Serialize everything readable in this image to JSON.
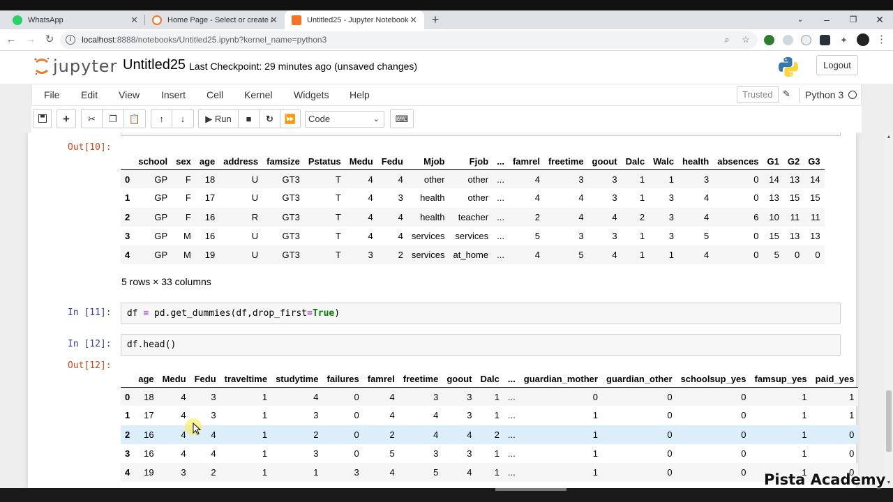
{
  "browser": {
    "tabs": [
      {
        "label": "WhatsApp",
        "icon": "whatsapp-icon",
        "active": false
      },
      {
        "label": "Home Page - Select or create a n",
        "icon": "jupyter-icon",
        "active": false
      },
      {
        "label": "Untitled25 - Jupyter Notebook",
        "icon": "jupyter-notebook-icon",
        "active": true
      }
    ],
    "url_host": "localhost",
    "url_path": ":8888/notebooks/Untitled25.ipynb?kernel_name=python3"
  },
  "jupyter": {
    "logo_text": "jupyter",
    "notebook_name": "Untitled25",
    "checkpoint": "Last Checkpoint: 29 minutes ago",
    "unsaved": "(unsaved changes)",
    "logout_label": "Logout",
    "menu": [
      "File",
      "Edit",
      "View",
      "Insert",
      "Cell",
      "Kernel",
      "Widgets",
      "Help"
    ],
    "trusted_label": "Trusted",
    "kernel_name": "Python 3",
    "run_label": "Run",
    "cell_type": "Code"
  },
  "cells": {
    "out10_prompt": "Out[10]:",
    "out10_shape": "5 rows × 33 columns",
    "out10_columns": [
      "",
      "school",
      "sex",
      "age",
      "address",
      "famsize",
      "Pstatus",
      "Medu",
      "Fedu",
      "Mjob",
      "Fjob",
      "...",
      "famrel",
      "freetime",
      "goout",
      "Dalc",
      "Walc",
      "health",
      "absences",
      "G1",
      "G2",
      "G3"
    ],
    "out10_rows": [
      [
        "0",
        "GP",
        "F",
        "18",
        "U",
        "GT3",
        "T",
        "4",
        "4",
        "other",
        "other",
        "...",
        "4",
        "3",
        "3",
        "1",
        "1",
        "3",
        "0",
        "14",
        "13",
        "14"
      ],
      [
        "1",
        "GP",
        "F",
        "17",
        "U",
        "GT3",
        "T",
        "4",
        "3",
        "health",
        "other",
        "...",
        "4",
        "4",
        "3",
        "1",
        "3",
        "4",
        "0",
        "13",
        "15",
        "15"
      ],
      [
        "2",
        "GP",
        "F",
        "16",
        "R",
        "GT3",
        "T",
        "4",
        "4",
        "health",
        "teacher",
        "...",
        "2",
        "4",
        "4",
        "2",
        "3",
        "4",
        "6",
        "10",
        "11",
        "11"
      ],
      [
        "3",
        "GP",
        "M",
        "16",
        "U",
        "GT3",
        "T",
        "4",
        "4",
        "services",
        "services",
        "...",
        "5",
        "3",
        "3",
        "1",
        "3",
        "5",
        "0",
        "15",
        "13",
        "13"
      ],
      [
        "4",
        "GP",
        "M",
        "19",
        "U",
        "GT3",
        "T",
        "3",
        "2",
        "services",
        "at_home",
        "...",
        "4",
        "5",
        "4",
        "1",
        "1",
        "4",
        "0",
        "5",
        "0",
        "0"
      ]
    ],
    "in11_prompt": "In [11]:",
    "in11_code": {
      "a": "df",
      "eq": "=",
      "b": "pd.get_dummies(df,drop_first",
      "eq2": "=",
      "kw": "True",
      "c": ")"
    },
    "in12_prompt": "In [12]:",
    "in12_code": "df.head()",
    "out12_prompt": "Out[12]:",
    "out12_columns": [
      "",
      "age",
      "Medu",
      "Fedu",
      "traveltime",
      "studytime",
      "failures",
      "famrel",
      "freetime",
      "goout",
      "Dalc",
      "...",
      "guardian_mother",
      "guardian_other",
      "schoolsup_yes",
      "famsup_yes",
      "paid_yes"
    ],
    "out12_rows": [
      [
        "0",
        "18",
        "4",
        "3",
        "1",
        "4",
        "0",
        "4",
        "3",
        "3",
        "1",
        "...",
        "0",
        "0",
        "0",
        "1",
        "1"
      ],
      [
        "1",
        "17",
        "4",
        "3",
        "1",
        "3",
        "0",
        "4",
        "4",
        "3",
        "1",
        "...",
        "1",
        "0",
        "0",
        "1",
        "1"
      ],
      [
        "2",
        "16",
        "4",
        "4",
        "1",
        "2",
        "0",
        "2",
        "4",
        "4",
        "2",
        "...",
        "1",
        "0",
        "0",
        "1",
        "0"
      ],
      [
        "3",
        "16",
        "4",
        "4",
        "1",
        "3",
        "0",
        "5",
        "3",
        "3",
        "1",
        "...",
        "1",
        "0",
        "0",
        "1",
        "0"
      ],
      [
        "4",
        "19",
        "3",
        "2",
        "1",
        "1",
        "3",
        "4",
        "5",
        "4",
        "1",
        "...",
        "1",
        "0",
        "0",
        "1",
        "0"
      ]
    ]
  },
  "watermark": "Pista Academy",
  "colors": {
    "out_prompt": "#d84315",
    "in_prompt": "#303f9f",
    "keyword": "#008000",
    "operator": "#aa22ff",
    "highlight_row": "#ddeefb"
  }
}
